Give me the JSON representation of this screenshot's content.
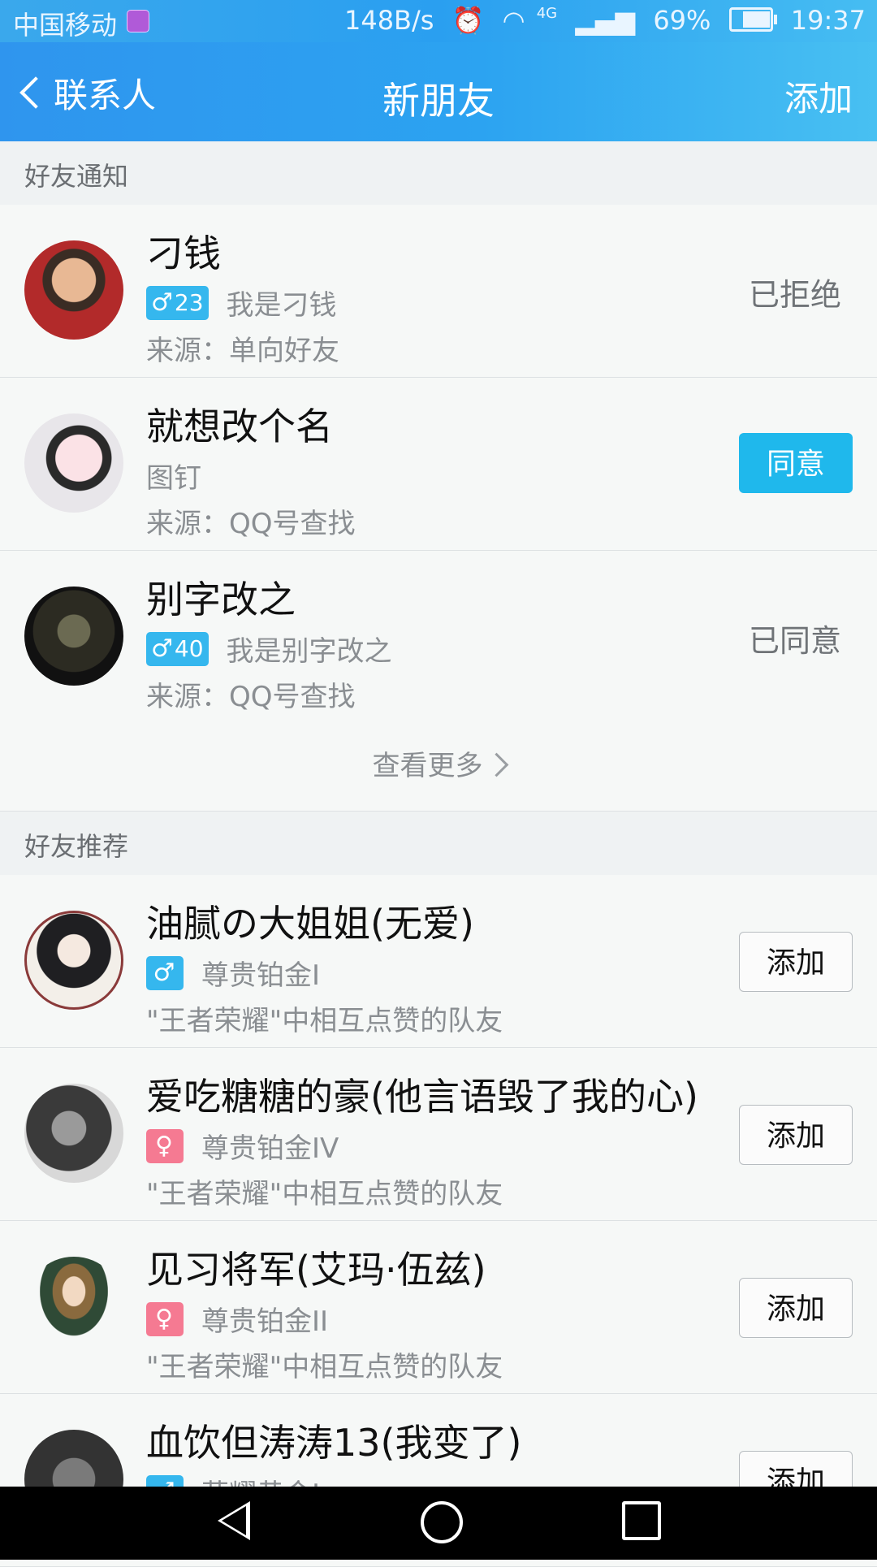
{
  "status_bar": {
    "carrier": "中国移动",
    "net_speed": "148B/s",
    "network_type": "4G",
    "battery": "69%",
    "battery_level": 0.69,
    "time": "19:37"
  },
  "nav": {
    "back_label": "联系人",
    "title": "新朋友",
    "add_label": "添加"
  },
  "notifications": {
    "header": "好友通知",
    "items": [
      {
        "name": "刁钱",
        "badge_symbol": "♂",
        "age": "23",
        "message": "我是刁钱",
        "source": "来源：单向好友",
        "status": "已拒绝"
      },
      {
        "name": "就想改个名",
        "message": "图钉",
        "source": "来源：QQ号查找",
        "action": "同意"
      },
      {
        "name": "别字改之",
        "badge_symbol": "♂",
        "age": "40",
        "message": "我是别字改之",
        "source": "来源：QQ号查找",
        "status": "已同意"
      }
    ],
    "more_label": "查看更多"
  },
  "recommendations": {
    "header": "好友推荐",
    "items": [
      {
        "name": "油腻の大姐姐(无爱)",
        "badge_symbol": "♂",
        "rank": "尊贵铂金I",
        "reason": "\"王者荣耀\"中相互点赞的队友",
        "action": "添加"
      },
      {
        "name": "爱吃糖糖的豪(他言语毁了我的心)",
        "badge_symbol": "♀",
        "rank": "尊贵铂金IV",
        "reason": "\"王者荣耀\"中相互点赞的队友",
        "action": "添加"
      },
      {
        "name": "见习将军(艾玛·伍兹)",
        "badge_symbol": "♀",
        "rank": "尊贵铂金II",
        "reason": "\"王者荣耀\"中相互点赞的队友",
        "action": "添加"
      },
      {
        "name": "血饮但涛涛13(我变了)",
        "badge_symbol": "♂",
        "rank": "荣耀黄金I",
        "reason": "",
        "action": "添加"
      }
    ]
  },
  "icons": {
    "sim": "sim-icon",
    "alarm": "alarm-icon",
    "wifi": "wifi-icon",
    "signal": "signal-icon",
    "battery": "battery-icon",
    "back": "chevron-left-icon",
    "more": "chevron-right-icon",
    "nav_back": "back-triangle-icon",
    "nav_home": "home-circle-icon",
    "nav_recent": "recent-square-icon"
  },
  "colors": {
    "header_gradient_start": "#2f95ee",
    "header_gradient_end": "#48c0f2",
    "agree_button": "#1fb8ec",
    "male_badge": "#35b7ee",
    "female_badge": "#f57a92"
  }
}
